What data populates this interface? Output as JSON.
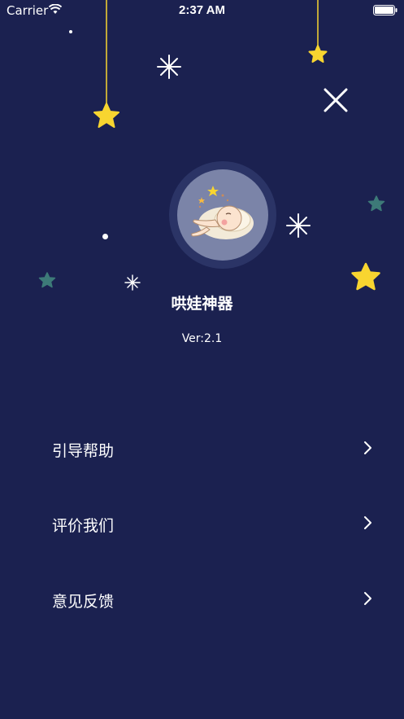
{
  "status_bar": {
    "carrier": "Carrier",
    "time": "2:37 AM"
  },
  "app": {
    "title": "哄娃神器",
    "version": "Ver:2.1"
  },
  "menu": {
    "items": [
      {
        "label": "引导帮助",
        "icon": "chevron-right-icon"
      },
      {
        "label": "评价我们",
        "icon": "chevron-right-icon"
      },
      {
        "label": "意见反馈",
        "icon": "chevron-right-icon"
      }
    ]
  },
  "colors": {
    "background": "#1b2150",
    "star_yellow": "#f8d530",
    "star_teal": "#3d7a78",
    "text": "#ffffff"
  }
}
